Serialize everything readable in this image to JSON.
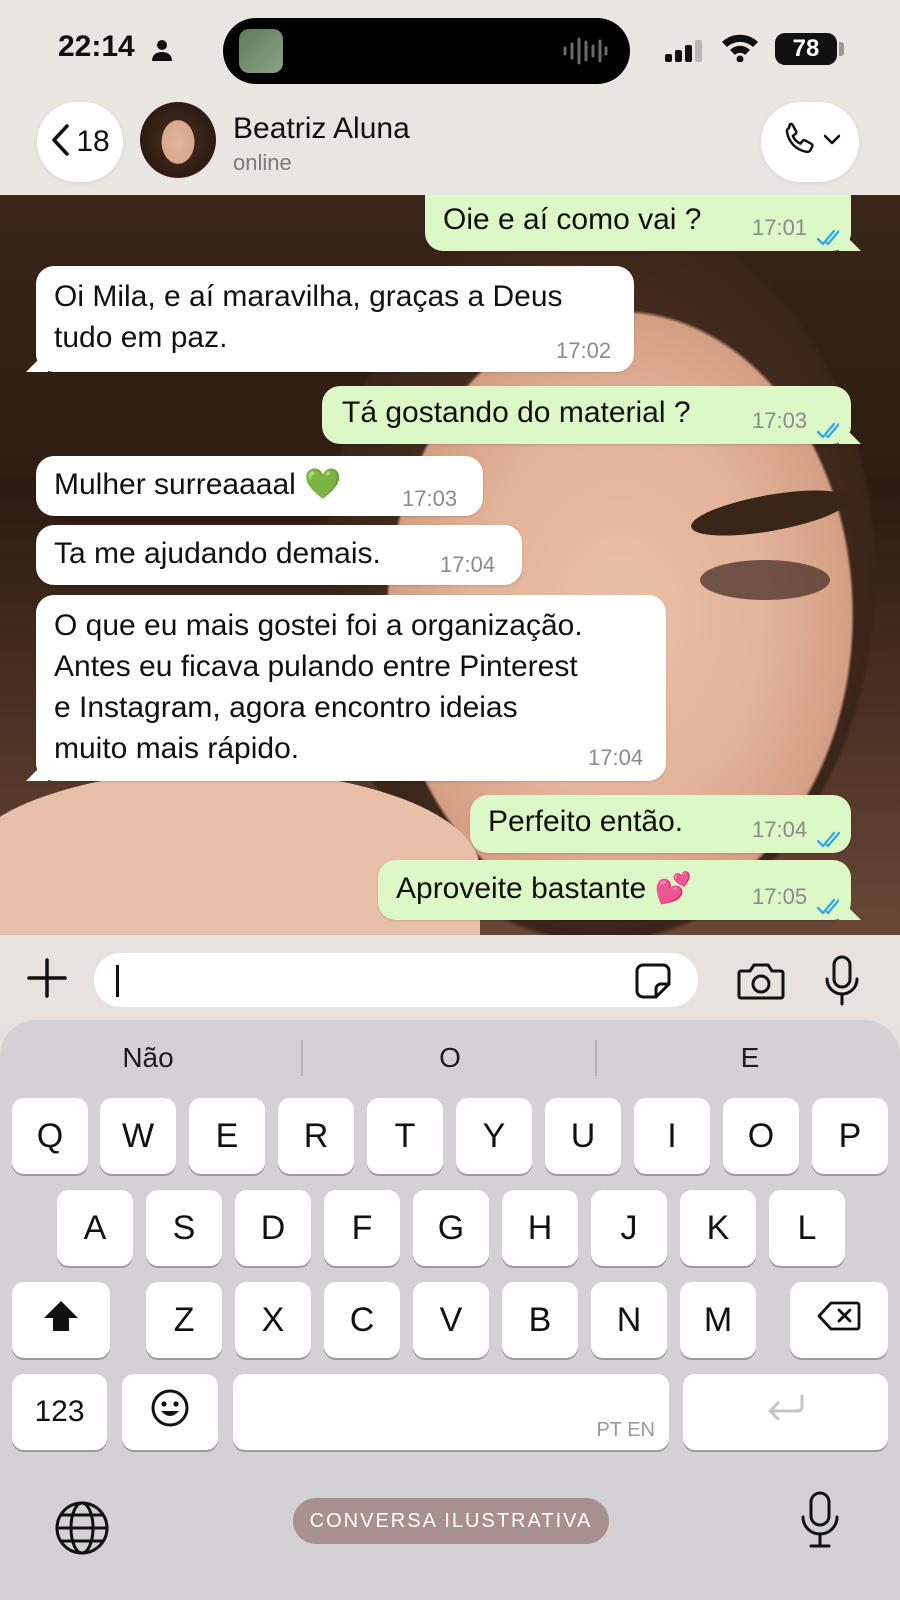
{
  "status_bar": {
    "time": "22:14",
    "battery": "78",
    "icons": [
      "person-icon",
      "signal-icon",
      "wifi-icon",
      "battery-icon",
      "audio-wave-icon"
    ]
  },
  "header": {
    "back_count": "18",
    "contact_name": "Beatriz Aluna",
    "contact_status": "online",
    "icons": [
      "chevron-left-icon",
      "phone-icon",
      "chevron-down-icon"
    ]
  },
  "messages": [
    {
      "dir": "out",
      "text": "Oie e aí como vai ?",
      "time": "17:01",
      "read": true
    },
    {
      "dir": "in",
      "text": "Oi Mila, e aí maravilha, graças a Deus\ntudo em paz.",
      "time": "17:02"
    },
    {
      "dir": "out",
      "text": "Tá gostando do material ?",
      "time": "17:03",
      "read": true
    },
    {
      "dir": "in",
      "text": "Mulher surreaaaal 💚",
      "time": "17:03"
    },
    {
      "dir": "in",
      "text": "Ta me ajudando demais.",
      "time": "17:04"
    },
    {
      "dir": "in",
      "text": "O que eu mais gostei foi a organização.\nAntes eu ficava pulando entre Pinterest\ne Instagram, agora encontro ideias\nmuito mais rápido.",
      "time": "17:04"
    },
    {
      "dir": "out",
      "text": "Perfeito então.",
      "time": "17:04",
      "read": true
    },
    {
      "dir": "out",
      "text": "Aproveite bastante 💕",
      "time": "17:05",
      "read": true
    }
  ],
  "composer": {
    "input_value": "",
    "icons": [
      "plus-icon",
      "sticker-icon",
      "camera-icon",
      "microphone-icon"
    ]
  },
  "keyboard": {
    "suggestions": [
      "Não",
      "O",
      "E"
    ],
    "row1": [
      "Q",
      "W",
      "E",
      "R",
      "T",
      "Y",
      "U",
      "I",
      "O",
      "P"
    ],
    "row2": [
      "A",
      "S",
      "D",
      "F",
      "G",
      "H",
      "J",
      "K",
      "L"
    ],
    "row3": [
      "Z",
      "X",
      "C",
      "V",
      "B",
      "N",
      "M"
    ],
    "numbers_label": "123",
    "space_label": "PT EN",
    "watermark": "CONVERSA ILUSTRATIVA",
    "icons": [
      "shift-icon",
      "backspace-icon",
      "emoji-icon",
      "return-icon",
      "globe-icon",
      "microphone-icon"
    ]
  },
  "colors": {
    "outgoing_bubble": "#dcf8c6",
    "incoming_bubble": "#ffffff",
    "read_ticks": "#34a7e8",
    "watermark_pill": "#a7908f"
  }
}
